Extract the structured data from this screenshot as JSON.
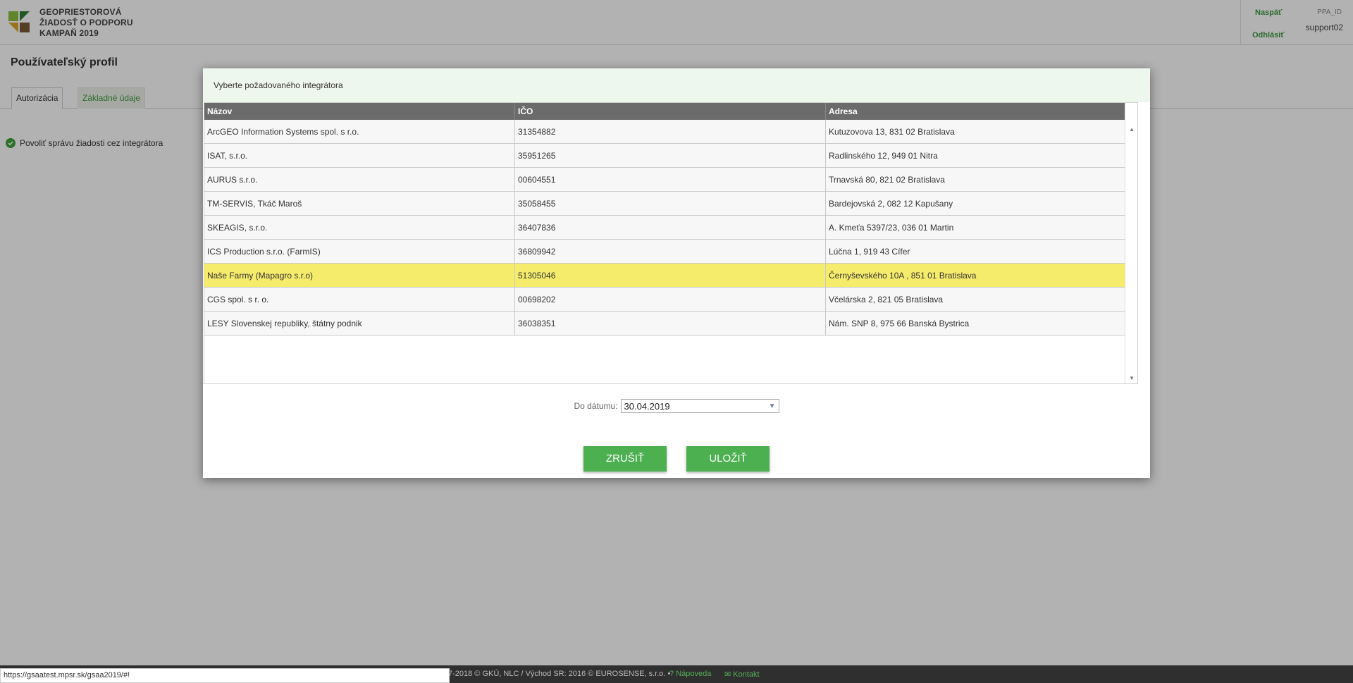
{
  "header": {
    "title_lines": [
      "GEOPRIESTOROVÁ",
      "ŽIADOSŤ O PODPORU",
      "KAMPAŇ 2019"
    ],
    "back_label": "Naspäť",
    "logout_label": "Odhlásiť",
    "user_label": "PPA_ID",
    "user_name": "support02"
  },
  "page": {
    "title": "Používateľský profil",
    "tabs": [
      {
        "label": "Autorizácia",
        "active": true
      },
      {
        "label": "Základné údaje",
        "active": false
      }
    ],
    "checkbox_label": "Povoliť správu žiadosti cez integrátora"
  },
  "modal": {
    "title": "Vyberte požadovaného integrátora",
    "columns": [
      "Názov",
      "IČO",
      "Adresa"
    ],
    "rows": [
      {
        "name": "ArcGEO Information Systems spol. s r.o.",
        "ico": "31354882",
        "address": "Kutuzovova 13, 831 02 Bratislava"
      },
      {
        "name": "ISAT, s.r.o.",
        "ico": "35951265",
        "address": "Radlinského 12, 949 01 Nitra"
      },
      {
        "name": "AURUS s.r.o.",
        "ico": "00604551",
        "address": "Trnavská 80, 821 02 Bratislava"
      },
      {
        "name": "TM-SERVIS, Tkáč Maroš",
        "ico": "35058455",
        "address": "Bardejovská 2, 082 12 Kapušany"
      },
      {
        "name": "SKEAGIS, s.r.o.",
        "ico": "36407836",
        "address": "A. Kmeťa 5397/23, 036 01 Martin"
      },
      {
        "name": "ICS Production s.r.o. (FarmIS)",
        "ico": "36809942",
        "address": "Lúčna 1, 919 43 Cífer"
      },
      {
        "name": "Naše Farmy (Mapagro s.r.o)",
        "ico": "51305046",
        "address": "Černyševského 10A , 851 01 Bratislava",
        "selected": true
      },
      {
        "name": "CGS spol. s r. o.",
        "ico": "00698202",
        "address": "Včelárska 2, 821 05 Bratislava"
      },
      {
        "name": "LESY Slovenskej republiky, štátny podnik",
        "ico": "36038351",
        "address": "Nám. SNP 8, 975 66 Banská Bystrica"
      }
    ],
    "date_label": "Do dátumu:",
    "date_value": "30.04.2019",
    "cancel_label": "ZRUŠIŤ",
    "save_label": "ULOŽIŤ"
  },
  "footer": {
    "copyright": "7-2018 © GKÚ, NLC / Východ SR: 2016 © EUROSENSE, s.r.o.  •",
    "help_label": "Nápoveda",
    "contact_label": "Kontakt",
    "status_url": "https://gsaatest.mpsr.sk/gsaa2019/#!"
  },
  "colors": {
    "accent_green": "#4caf50",
    "selected_row": "#f6ec6c",
    "grid_header": "#6b6b6b"
  }
}
